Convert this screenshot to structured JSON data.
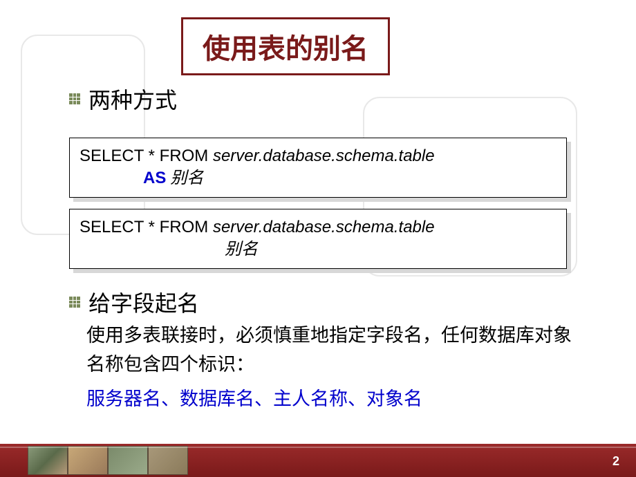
{
  "title": "使用表的别名",
  "bullets": {
    "first": "两种方式",
    "second": "给字段起名"
  },
  "code1": {
    "prefix": "SELECT * FROM ",
    "path": "server.database.schema.table",
    "keyword": "AS",
    "alias": " 别名"
  },
  "code2": {
    "prefix": "SELECT * FROM ",
    "path": "server.database.schema.table",
    "alias": "别名"
  },
  "description": "使用多表联接时，必须慎重地指定字段名，任何数据库对象名称包含四个标识：",
  "identifiers": "服务器名、数据库名、主人名称、对象名",
  "pageNumber": "2"
}
